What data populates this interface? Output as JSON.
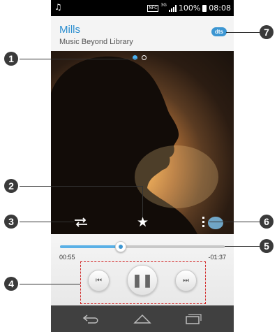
{
  "status_bar": {
    "music_note": "♫",
    "nfc": "NFC",
    "network": "3G",
    "battery_percent": "100%",
    "time": "08:08"
  },
  "header": {
    "song_title": "Mills",
    "album": "Music Beyond Library",
    "dts_label": "dts"
  },
  "pager": {
    "active_index": 0,
    "count": 2
  },
  "art_controls": {
    "repeat_icon": "repeat-icon",
    "star_icon": "★",
    "menu_icon": "more-icon",
    "eq_icon": "equalizer-icon"
  },
  "playback": {
    "elapsed": "00:55",
    "remaining": "-01:37",
    "progress_fraction": 0.37,
    "prev_symbol": "⏮",
    "pause_symbol": "❚❚",
    "next_symbol": "⏭"
  },
  "callouts": [
    "1",
    "2",
    "3",
    "4",
    "5",
    "6",
    "7"
  ],
  "colors": {
    "accent": "#2e8fd0",
    "callout": "#3a3a3a",
    "highlight": "#d22a2a"
  }
}
